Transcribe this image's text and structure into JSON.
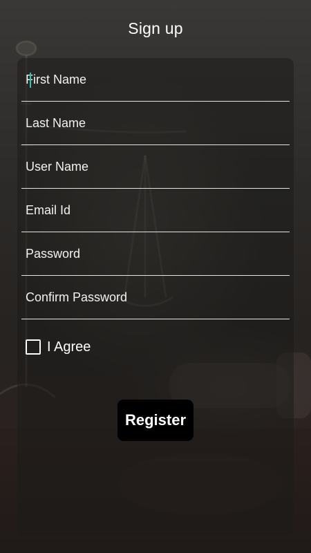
{
  "page": {
    "title": "Sign up"
  },
  "form": {
    "fields": [
      {
        "placeholder": "First Name",
        "value": ""
      },
      {
        "placeholder": "Last Name",
        "value": ""
      },
      {
        "placeholder": "User Name",
        "value": ""
      },
      {
        "placeholder": "Email Id",
        "value": ""
      },
      {
        "placeholder": "Password",
        "value": ""
      },
      {
        "placeholder": "Confirm Password",
        "value": ""
      }
    ],
    "agree_label": "I Agree",
    "agree_checked": false,
    "register_label": "Register"
  },
  "colors": {
    "caret": "#2ec4b6",
    "text": "#ffffff",
    "button_bg": "#000000",
    "divider": "#e6e6e6"
  },
  "background": {
    "icon": "scales-of-justice-and-gavel-photo"
  }
}
